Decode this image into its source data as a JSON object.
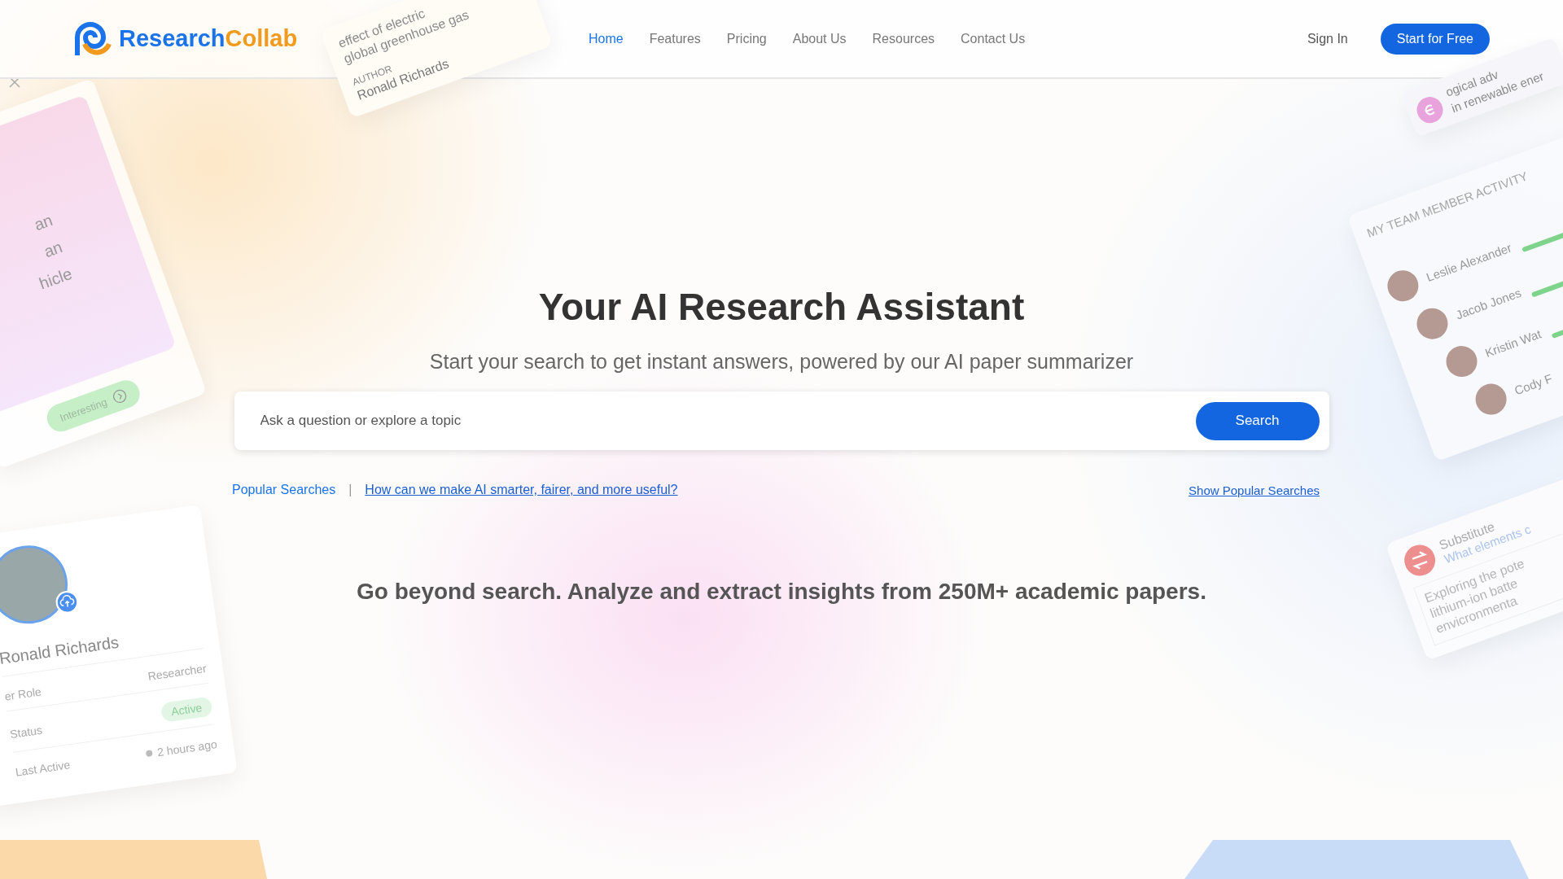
{
  "header": {
    "logo": {
      "part_1": "Research",
      "part_2": "Collab"
    },
    "nav": [
      {
        "label": "Home",
        "selected": true
      },
      {
        "label": "Features",
        "selected": false
      },
      {
        "label": "Pricing",
        "selected": false
      },
      {
        "label": "About Us",
        "selected": false
      },
      {
        "label": "Resources",
        "selected": false
      },
      {
        "label": "Contact Us",
        "selected": false
      }
    ],
    "sign_in": "Sign In",
    "cta": "Start for Free"
  },
  "hero": {
    "title": "Your AI Research Assistant",
    "subtitle": "Start your search to get instant answers, powered by our AI paper summarizer",
    "search": {
      "placeholder": "Ask a question or explore a topic",
      "button": "Search"
    },
    "popular": {
      "label": "Popular Searches",
      "separator": "|",
      "link": "How can we make AI smarter, fairer, and more useful?"
    },
    "show_popular": "Show Popular Searches",
    "tagline": "Go beyond search. Analyze and extract insights from 250M+ academic papers."
  },
  "decor": {
    "paper_card": {
      "lines": [
        "effect of electric",
        "global greenhouse gas"
      ],
      "author_label": "AUTHOR",
      "author": "Ronald Richards"
    },
    "topic_card": {
      "lines": [
        "an",
        "an",
        "hicle"
      ],
      "tag": "Interesting"
    },
    "profile_card": {
      "name": "Ronald Richards",
      "rows": [
        {
          "label": "er Role",
          "value": "Researcher",
          "kind": "text"
        },
        {
          "label": "Status",
          "value": "Active",
          "kind": "badge"
        },
        {
          "label": "Last Active",
          "value": "2 hours ago",
          "kind": "dot"
        }
      ]
    },
    "advice_card": {
      "lines": [
        "ogical adv",
        "in renewable ener"
      ]
    },
    "team_card": {
      "title": "MY TEAM MEMBER ACTIVITY",
      "members": [
        {
          "name": "Leslie Alexander"
        },
        {
          "name": "Jacob Jones"
        },
        {
          "name": "Kristin Wat"
        },
        {
          "name": "Cody F"
        }
      ]
    },
    "substitute_card": {
      "title": "Substitute",
      "subtitle": "What elements c",
      "lines": [
        "Exploring the pote",
        "lithium-ion batte",
        "envicronmenta"
      ]
    }
  }
}
